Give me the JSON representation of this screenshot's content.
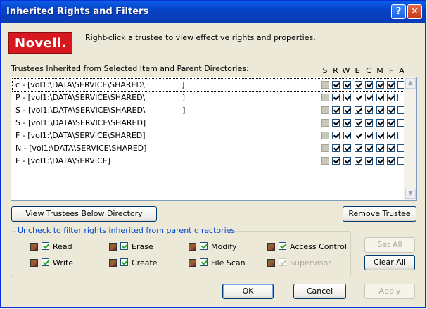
{
  "window": {
    "title": "Inherited Rights and Filters"
  },
  "logo": {
    "text": "Novell."
  },
  "hint": "Right-click a trustee to view effective rights and properties.",
  "trustees": {
    "label": "Trustees Inherited from Selected Item and Parent Directories:",
    "columns": [
      "S",
      "R",
      "W",
      "E",
      "C",
      "M",
      "F",
      "A"
    ],
    "rows": [
      {
        "text": "c - [vol1:\\DATA\\SERVICE\\SHARED\\               ]",
        "rights": [
          false,
          true,
          true,
          true,
          true,
          true,
          true,
          false
        ],
        "selected": true
      },
      {
        "text": "P - [vol1:\\DATA\\SERVICE\\SHARED\\               ]",
        "rights": [
          false,
          true,
          true,
          true,
          true,
          true,
          true,
          false
        ],
        "selected": false
      },
      {
        "text": "S - [vol1:\\DATA\\SERVICE\\SHARED\\               ]",
        "rights": [
          false,
          true,
          true,
          true,
          true,
          true,
          true,
          false
        ],
        "selected": false
      },
      {
        "text": "S - [vol1:\\DATA\\SERVICE\\SHARED]",
        "rights": [
          false,
          true,
          true,
          true,
          true,
          true,
          true,
          false
        ],
        "selected": false
      },
      {
        "text": "F - [vol1:\\DATA\\SERVICE\\SHARED]",
        "rights": [
          false,
          true,
          true,
          true,
          true,
          true,
          true,
          false
        ],
        "selected": false
      },
      {
        "text": "N - [vol1:\\DATA\\SERVICE\\SHARED]",
        "rights": [
          false,
          true,
          true,
          true,
          true,
          true,
          true,
          false
        ],
        "selected": false
      },
      {
        "text": "F - [vol1:\\DATA\\SERVICE]",
        "rights": [
          false,
          true,
          true,
          true,
          true,
          true,
          true,
          false
        ],
        "selected": false
      }
    ]
  },
  "buttons": {
    "view_trustees": "View Trustees Below Directory",
    "remove_trustee": "Remove Trustee",
    "set_all": "Set All",
    "clear_all": "Clear All",
    "ok": "OK",
    "cancel": "Cancel",
    "apply": "Apply"
  },
  "filters": {
    "label": "Uncheck to filter rights inherited from parent directories",
    "items": [
      {
        "label": "Read",
        "checked": true,
        "enabled": true
      },
      {
        "label": "Erase",
        "checked": true,
        "enabled": true
      },
      {
        "label": "Modify",
        "checked": true,
        "enabled": true
      },
      {
        "label": "Access Control",
        "checked": true,
        "enabled": true
      },
      {
        "label": "Write",
        "checked": true,
        "enabled": true
      },
      {
        "label": "Create",
        "checked": true,
        "enabled": true
      },
      {
        "label": "File Scan",
        "checked": true,
        "enabled": true
      },
      {
        "label": "Supervisor",
        "checked": true,
        "enabled": false
      }
    ]
  },
  "colors": {
    "title_bar": "#0842C6",
    "accent": "#0046D5",
    "logo": "#D7191F"
  }
}
